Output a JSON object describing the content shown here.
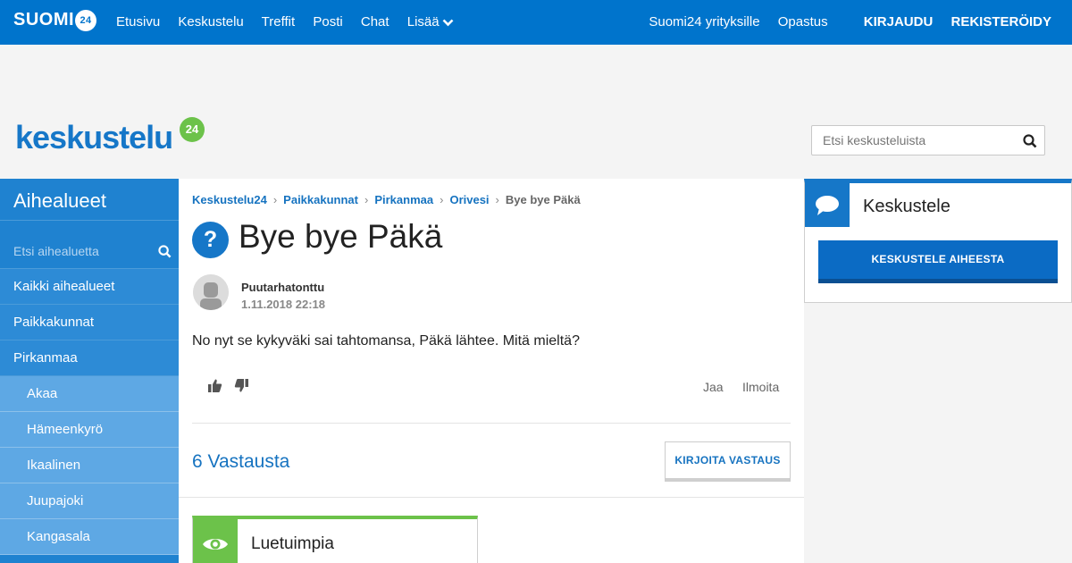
{
  "colors": {
    "brand": "#0074cc",
    "accent_green": "#6cc24a",
    "link": "#1673c0"
  },
  "topnav": {
    "brand": "SUOMI",
    "brand_badge": "24",
    "links": [
      "Etusivu",
      "Keskustelu",
      "Treffit",
      "Posti",
      "Chat",
      "Lisää"
    ],
    "business": "Suomi24 yrityksille",
    "guide": "Opastus",
    "login": "KIRJAUDU",
    "register": "REKISTERÖIDY"
  },
  "header": {
    "logo_text": "keskustelu",
    "logo_badge": "24",
    "search_placeholder": "Etsi keskusteluista"
  },
  "sidebar": {
    "title": "Aihealueet",
    "search_placeholder": "Etsi aihealuetta",
    "items": [
      "Kaikki aihealueet",
      "Paikkakunnat",
      "Pirkanmaa"
    ],
    "subitems": [
      "Akaa",
      "Hämeenkyrö",
      "Ikaalinen",
      "Juupajoki",
      "Kangasala"
    ]
  },
  "thread": {
    "breadcrumbs": [
      "Keskustelu24",
      "Paikkakunnat",
      "Pirkanmaa",
      "Orivesi"
    ],
    "breadcrumb_current": "Bye bye Päkä",
    "question_icon": "?",
    "title": "Bye bye Päkä",
    "author": "Puutarhatonttu",
    "date": "1.11.2018 22:18",
    "body": "No nyt se kykyväki sai tahtomansa, Päkä lähtee. Mitä mieltä?",
    "share": "Jaa",
    "report": "Ilmoita",
    "replies_count": "6 Vastausta",
    "reply_button": "KIRJOITA VASTAUS",
    "popular_title": "Luetuimpia"
  },
  "widget": {
    "title": "Keskustele",
    "button": "KESKUSTELE AIHEESTA"
  }
}
